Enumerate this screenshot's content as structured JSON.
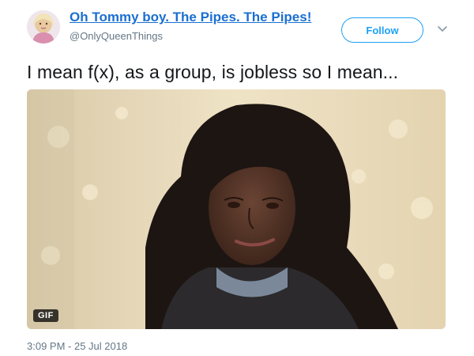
{
  "tweet": {
    "display_name": "Oh Tommy boy. The Pipes. The Pipes!",
    "handle": "@OnlyQueenThings",
    "follow_label": "Follow",
    "text": "I mean f(x), as a group, is jobless so I mean...",
    "media_badge": "GIF",
    "timestamp": "3:09 PM - 25 Jul 2018"
  },
  "colors": {
    "name_link": "#1b6fd0",
    "accent": "#1da1f2",
    "secondary_text": "#657786"
  },
  "icons": {
    "menu": "chevron-down-icon"
  }
}
